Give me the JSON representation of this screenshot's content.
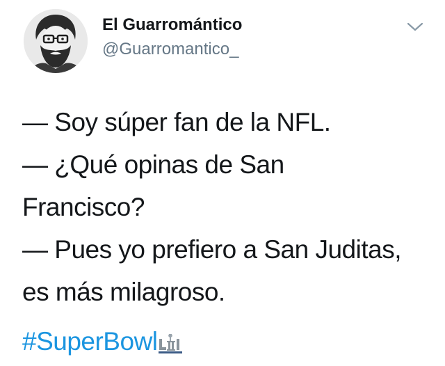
{
  "author": {
    "display_name": "El Guarromántico",
    "handle": "@Guarromantico_"
  },
  "tweet": {
    "lines": [
      "— Soy súper fan de la NFL.",
      "— ¿Qué opinas de San",
      "Francisco?",
      "— Pues yo prefiero a San Juditas,",
      "es más milagroso."
    ],
    "hashtag": "#SuperBowl",
    "hashflag_icon": "super-bowl-lii-trophy"
  },
  "colors": {
    "hashtag": "#1b95e0",
    "handle": "#657786",
    "text": "#14171a",
    "caret": "#8899a6"
  },
  "icons": {
    "menu": "chevron-down-icon",
    "avatar": "bearded-man-with-glasses-avatar"
  }
}
